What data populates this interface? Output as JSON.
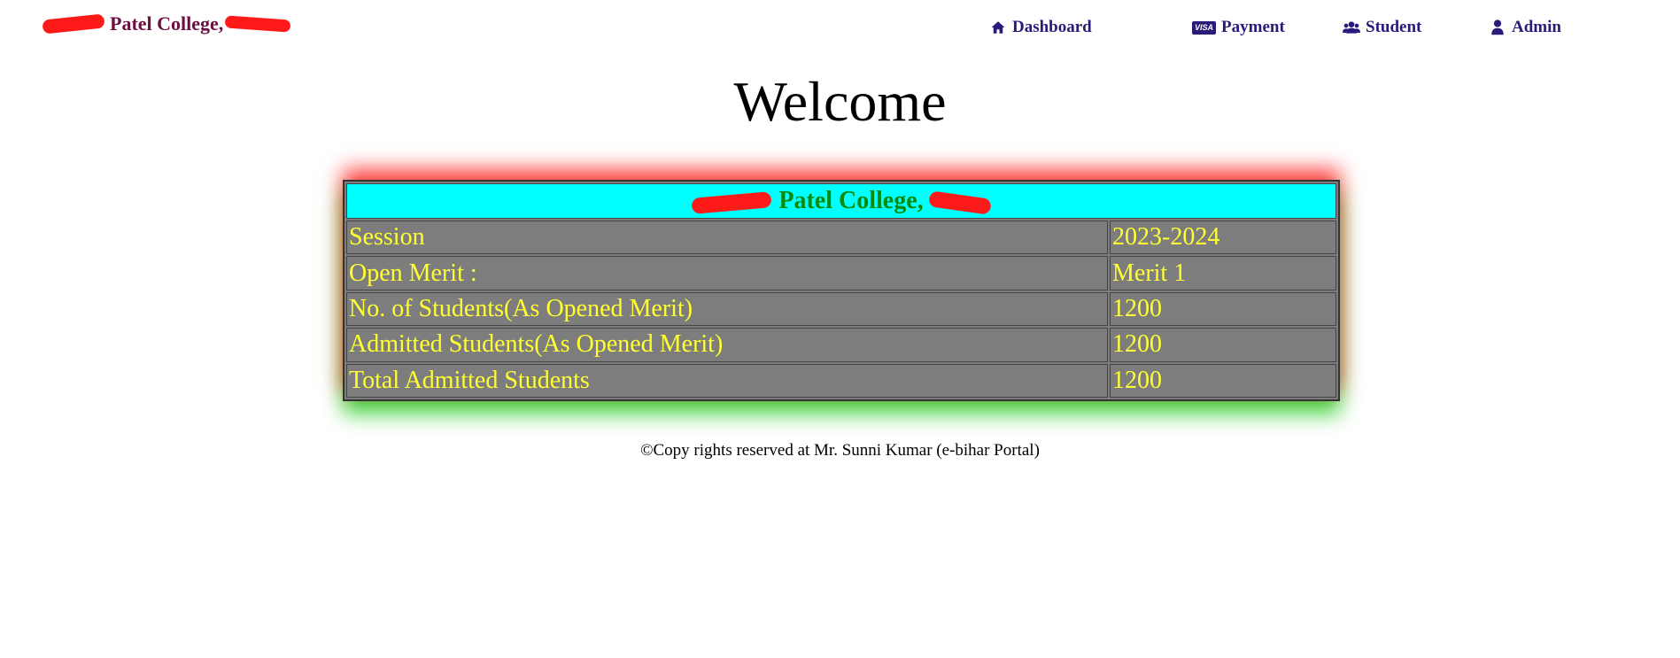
{
  "header": {
    "brand_text": "Patel College,",
    "nav": [
      {
        "label": "Dashboard",
        "icon": "home-icon"
      },
      {
        "label": "Payment",
        "icon": "visa-card-icon",
        "badge": "VISA"
      },
      {
        "label": "Student",
        "icon": "users-icon"
      },
      {
        "label": "Admin",
        "icon": "user-icon"
      }
    ]
  },
  "main": {
    "heading": "Welcome",
    "table": {
      "caption": "Patel College,",
      "rows": [
        {
          "label": "Session",
          "value": "2023-2024"
        },
        {
          "label": "Open Merit :",
          "value": "Merit 1"
        },
        {
          "label": "No. of Students(As Opened Merit)",
          "value": "1200"
        },
        {
          "label": "Admitted Students(As Opened Merit)",
          "value": "1200"
        },
        {
          "label": "Total Admitted Students",
          "value": "1200"
        }
      ]
    }
  },
  "footer": {
    "text": "©Copy rights reserved at Mr. Sunni Kumar (e-bihar Portal)"
  },
  "colors": {
    "brand": "#6b1040",
    "nav": "#2a1a7a",
    "caption_bg": "#00ffff",
    "caption_text": "#0a8a0a",
    "cell_bg": "#7d7d7d",
    "cell_text": "#ffff33",
    "shadow_top": "#ff0000",
    "shadow_bottom": "#00c800"
  }
}
